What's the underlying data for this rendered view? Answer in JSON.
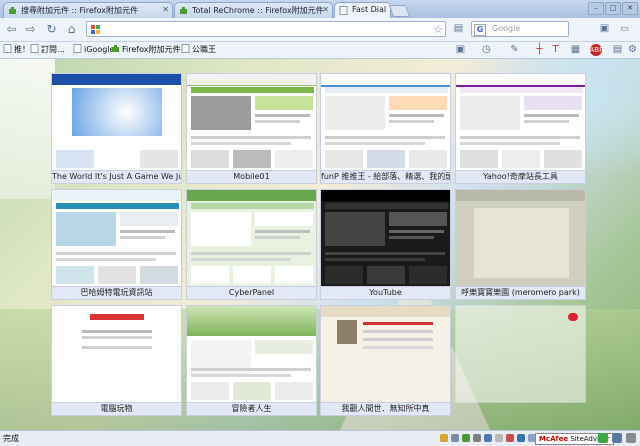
{
  "tabs": [
    {
      "title": "搜尋附加元件 :: Firefox附加元件",
      "icon": "puzzle-icon",
      "active": false
    },
    {
      "title": "Total ReChrome :: Firefox附加元件",
      "icon": "puzzle-icon",
      "active": false
    },
    {
      "title": "Fast Dial",
      "icon": "page-icon",
      "active": true
    }
  ],
  "toolbar": {
    "address_value": "",
    "search_placeholder": "Google"
  },
  "bookmarks": [
    {
      "label": "推！",
      "icon": "page-icon"
    },
    {
      "label": "訂閱…",
      "icon": "page-icon"
    },
    {
      "label": "iGoogle",
      "icon": "page-icon"
    },
    {
      "label": "Firefox附加元件",
      "icon": "puzzle-icon"
    },
    {
      "label": "公職王",
      "icon": "page-icon"
    }
  ],
  "dials": [
    {
      "caption": "The World It's Just A Game We Just P"
    },
    {
      "caption": "Mobile01"
    },
    {
      "caption": "funP 推推王 - 給部落、精選、我的頭"
    },
    {
      "caption": "Yahoo!奇摩站長工具"
    },
    {
      "caption": "巴哈姆特電玩資訊站"
    },
    {
      "caption": "CyberPanel"
    },
    {
      "caption": "YouTube"
    },
    {
      "caption": "呼樂寶寶樂園 (meromero park)"
    },
    {
      "caption": "電腦玩物"
    },
    {
      "caption": "冒險者人生"
    },
    {
      "caption": "我觀人間世．無知所中真"
    },
    {
      "caption": ""
    }
  ],
  "status": {
    "text": "完成",
    "mcafee_brand": "McAfee",
    "mcafee_product": "SiteAdvisor"
  },
  "colors": {
    "accent": "#3f6bb5",
    "puzzle_green": "#4f9a2e"
  }
}
